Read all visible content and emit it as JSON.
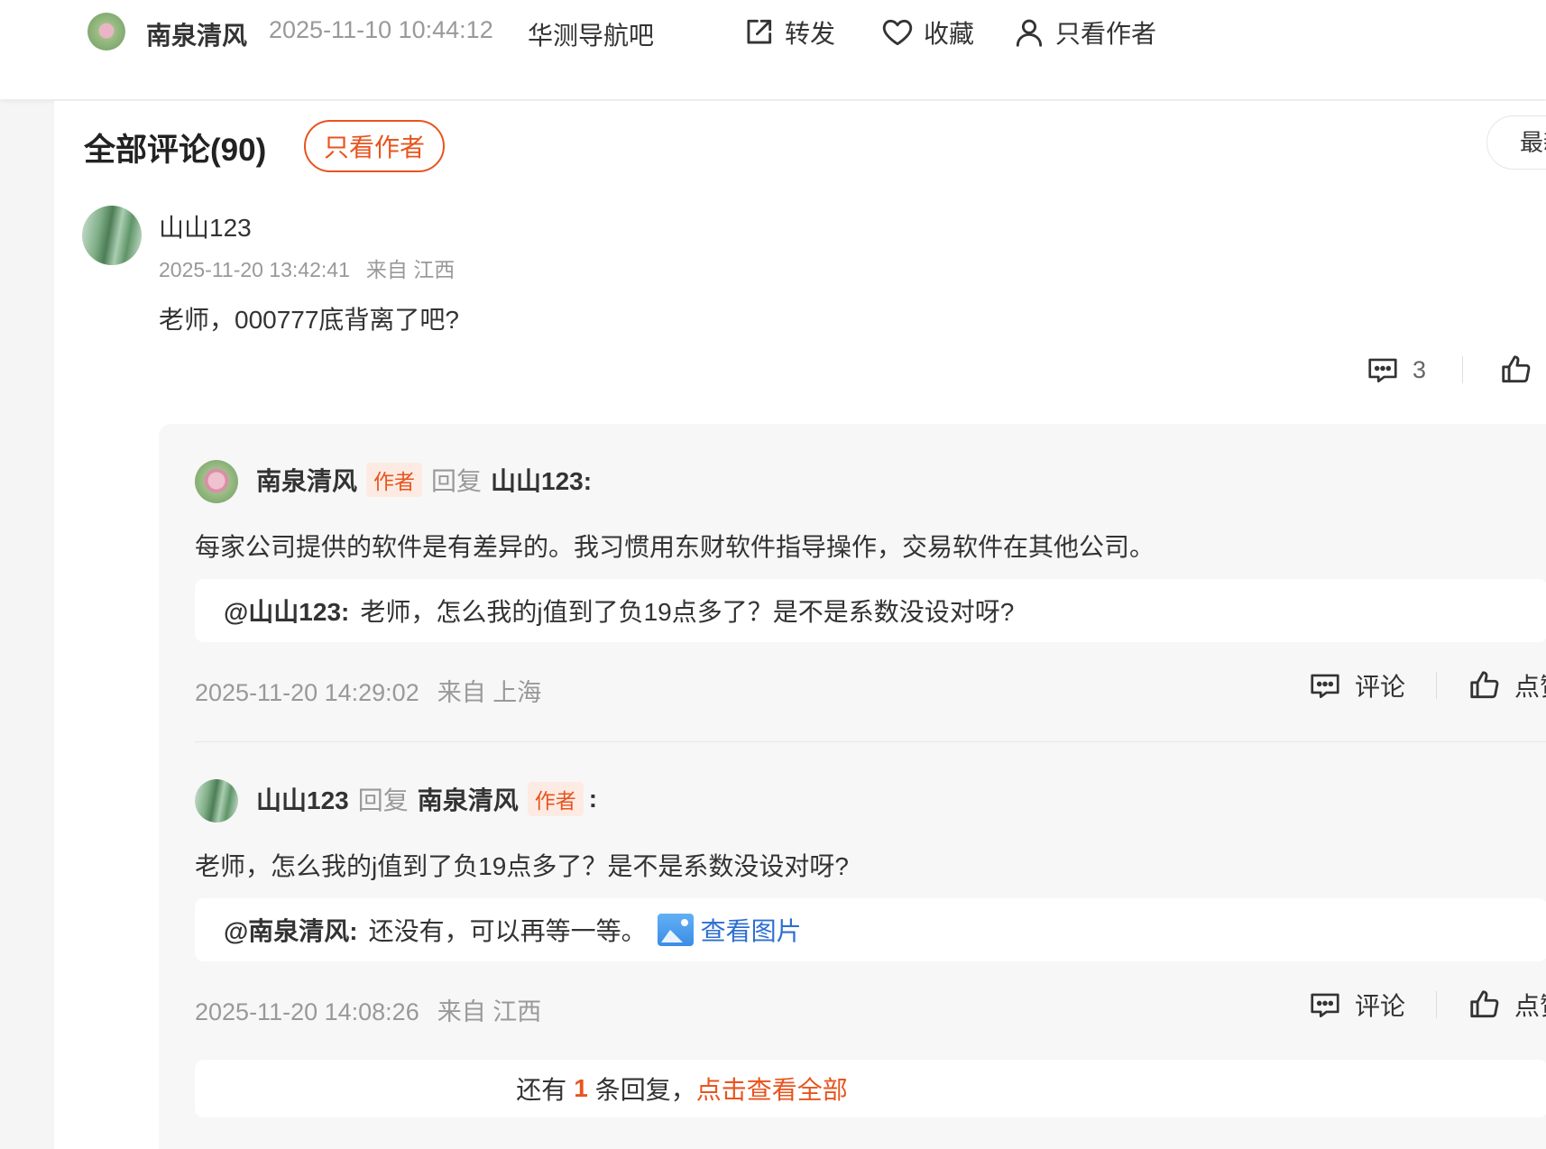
{
  "topbar": {
    "author": "南泉清风",
    "datetime": "2025-11-10 10:44:12",
    "bar_name": "华测导航吧",
    "share_label": "转发",
    "favorite_label": "收藏",
    "author_only_label": "只看作者"
  },
  "comments_header": {
    "title": "全部评论(90)",
    "author_only_button": "只看作者",
    "sort_label": "最新"
  },
  "comment": {
    "user": "山山123",
    "datetime": "2025-11-20 13:42:41",
    "location": "来自 江西",
    "text": "老师，000777底背离了吧?",
    "reply_count": "3"
  },
  "replies": [
    {
      "user": "南泉清风",
      "badge": "作者",
      "reply_word": "回复",
      "target": "山山123:",
      "text": "每家公司提供的软件是有差异的。我习惯用东财软件指导操作，交易软件在其他公司。",
      "quote_at": "@山山123:",
      "quote_text": "老师，怎么我的j值到了负19点多了？是不是系数没设对呀?",
      "datetime": "2025-11-20 14:29:02",
      "location": "来自 上海",
      "comment_label": "评论",
      "like_label": "点赞"
    },
    {
      "user": "山山123",
      "reply_word": "回复",
      "target": "南泉清风",
      "badge": "作者",
      "colon": ":",
      "text": "老师，怎么我的j值到了负19点多了？是不是系数没设对呀?",
      "quote_at": "@南泉清风:",
      "quote_text": "还没有，可以再等一等。",
      "image_link": "查看图片",
      "datetime": "2025-11-20 14:08:26",
      "location": "来自 江西",
      "comment_label": "评论",
      "like_label": "点赞"
    }
  ],
  "more_replies": {
    "prefix": "还有",
    "count": "1",
    "suffix": "条回复，",
    "link": "点击查看全部"
  }
}
